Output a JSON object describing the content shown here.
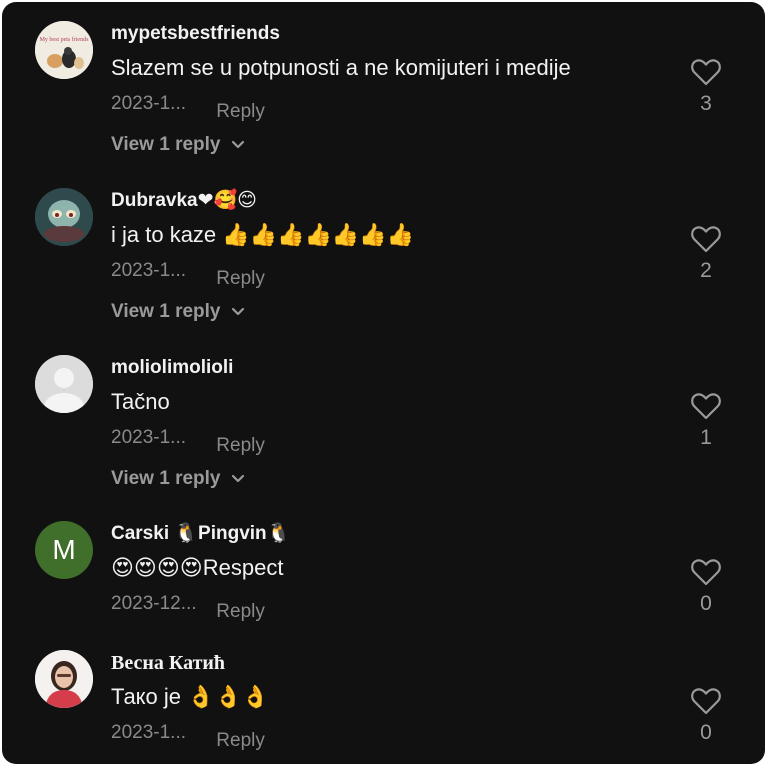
{
  "comments": [
    {
      "author": "mypetsbestfriends",
      "text": "Slazem se u potpunosti a ne komijuteri i medije",
      "date": "2023-1...",
      "reply": "Reply",
      "likes": "3",
      "view_replies": "View 1 reply",
      "avatar_caption": "My best pets friends"
    },
    {
      "author": "Dubravka❤🥰😊",
      "text": "i ja to kaze 👍👍👍👍👍👍👍",
      "date": "2023-1...",
      "reply": "Reply",
      "likes": "2",
      "view_replies": "View 1 reply"
    },
    {
      "author": "moliolimolioli",
      "text": "Tačno",
      "date": "2023-1...",
      "reply": "Reply",
      "likes": "1",
      "view_replies": "View 1 reply"
    },
    {
      "author": "Carski 🐧Pingvin🐧",
      "text": "😍😍😍😍Respect",
      "date": "2023-12...",
      "reply": "Reply",
      "likes": "0",
      "avatar_letter": "M"
    },
    {
      "author": "Весна Катић",
      "text": "Тако је 👌👌👌",
      "date": "2023-1...",
      "reply": "Reply",
      "likes": "0"
    }
  ],
  "colors": {
    "background": "#111111",
    "text": "#f2f2f2",
    "muted": "#8a8a8a",
    "avatar_green": "#3f6f2a"
  }
}
